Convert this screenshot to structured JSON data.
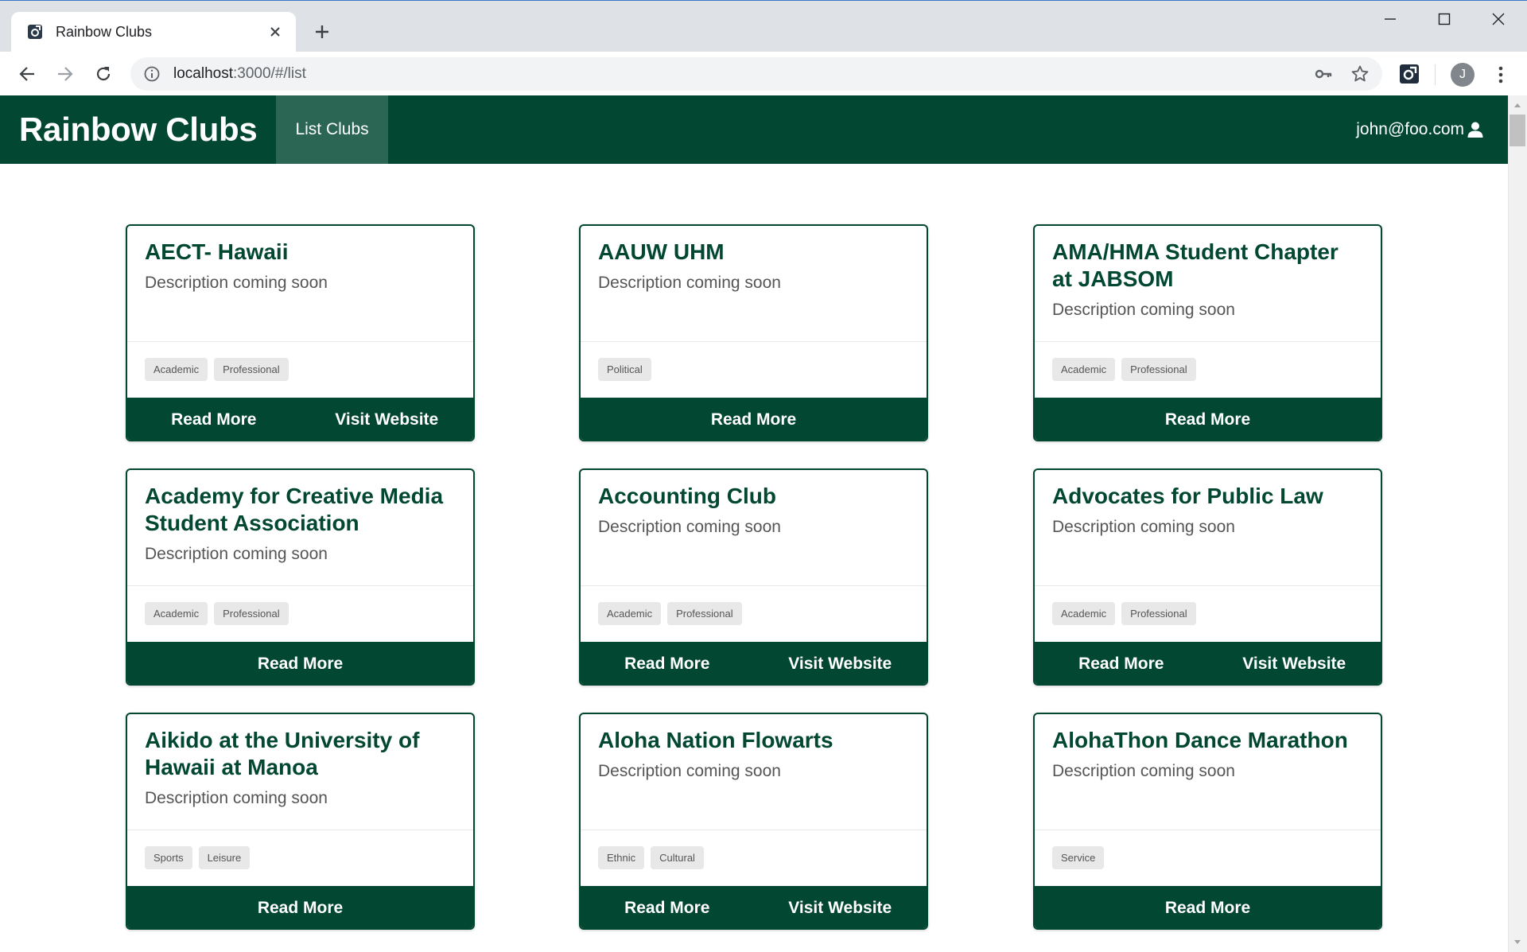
{
  "browser": {
    "tab_title": "Rainbow Clubs",
    "url_host": "localhost",
    "url_rest": ":3000/#/list",
    "profile_initial": "J"
  },
  "app": {
    "brand": "Rainbow Clubs",
    "nav_item": "List Clubs",
    "user_email": "john@foo.com",
    "colors": {
      "primary": "#024731",
      "nav_active": "#2b6654"
    }
  },
  "clubs": [
    {
      "name": "AECT- Hawaii",
      "description": "Description coming soon",
      "tags": [
        "Academic",
        "Professional"
      ],
      "buttons": [
        "Read More",
        "Visit Website"
      ]
    },
    {
      "name": "AAUW UHM",
      "description": "Description coming soon",
      "tags": [
        "Political"
      ],
      "buttons": [
        "Read More"
      ]
    },
    {
      "name": "AMA/HMA Student Chapter at JABSOM",
      "description": "Description coming soon",
      "tags": [
        "Academic",
        "Professional"
      ],
      "buttons": [
        "Read More"
      ]
    },
    {
      "name": "Academy for Creative Media Student Association",
      "description": "Description coming soon",
      "tags": [
        "Academic",
        "Professional"
      ],
      "buttons": [
        "Read More"
      ]
    },
    {
      "name": "Accounting Club",
      "description": "Description coming soon",
      "tags": [
        "Academic",
        "Professional"
      ],
      "buttons": [
        "Read More",
        "Visit Website"
      ]
    },
    {
      "name": "Advocates for Public Law",
      "description": "Description coming soon",
      "tags": [
        "Academic",
        "Professional"
      ],
      "buttons": [
        "Read More",
        "Visit Website"
      ]
    },
    {
      "name": "Aikido at the University of Hawaii at Manoa",
      "description": "Description coming soon",
      "tags": [
        "Sports",
        "Leisure"
      ],
      "buttons": [
        "Read More"
      ]
    },
    {
      "name": "Aloha Nation Flowarts",
      "description": "Description coming soon",
      "tags": [
        "Ethnic",
        "Cultural"
      ],
      "buttons": [
        "Read More",
        "Visit Website"
      ]
    },
    {
      "name": "AlohaThon Dance Marathon",
      "description": "Description coming soon",
      "tags": [
        "Service"
      ],
      "buttons": [
        "Read More"
      ]
    }
  ]
}
